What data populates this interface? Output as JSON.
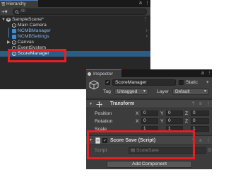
{
  "hierarchy": {
    "tab_label": "Hierarchy",
    "tab_controls": [
      "a",
      "⋮"
    ],
    "add_button": "+▾",
    "search_placeholder": "All",
    "items": [
      {
        "label": "SampleScene*",
        "kind": "scene",
        "expanded": true,
        "menu": "⋮"
      },
      {
        "label": "Main Camera",
        "kind": "gameobject"
      },
      {
        "label": "NCMBManager",
        "kind": "prefab",
        "has_children": true
      },
      {
        "label": "NCMBSettings",
        "kind": "prefab",
        "has_children": true
      },
      {
        "label": "Canvas",
        "kind": "gameobject",
        "collapsed": true
      },
      {
        "label": "EventSystem",
        "kind": "gameobject"
      },
      {
        "label": "ScoreManager",
        "kind": "gameobject",
        "selected": true
      }
    ]
  },
  "inspector": {
    "tab_label": "Inspector",
    "tab_controls": [
      "a",
      "⋮"
    ],
    "object_name": "ScoreManager",
    "active": true,
    "static_label": "Static",
    "tag_label": "Tag",
    "tag_value": "Untagged",
    "layer_label": "Layer",
    "layer_value": "Default",
    "transform": {
      "title": "Transform",
      "rows": [
        {
          "label": "Position",
          "x": "0",
          "y": "0",
          "z": "0"
        },
        {
          "label": "Rotation",
          "x": "0",
          "y": "0",
          "z": "0"
        },
        {
          "label": "Scale",
          "x": "1",
          "y": "1",
          "z": "1"
        }
      ],
      "axis_labels": [
        "X",
        "Y",
        "Z"
      ]
    },
    "script_component": {
      "title": "Score Save (Script)",
      "field_label": "Script",
      "field_value": "ScoreSave",
      "enabled": true
    },
    "add_component_label": "Add Component"
  },
  "colors": {
    "highlight": "#e41f26",
    "selection": "#2c5d87",
    "prefab_text": "#7ab6f2"
  }
}
